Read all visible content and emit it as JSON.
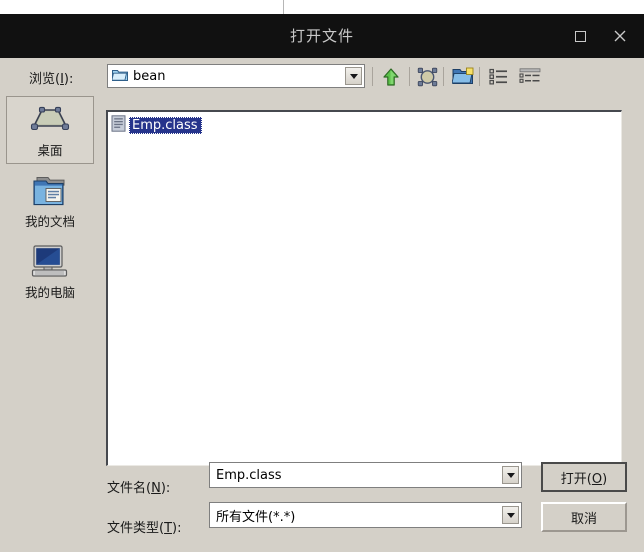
{
  "window": {
    "title": "打开文件",
    "maximize_icon": "maximize-icon",
    "close_icon": "close-icon"
  },
  "toolbar": {
    "browse_label_pre": "浏览(",
    "browse_label_key": "I",
    "browse_label_post": "):",
    "path_value": "bean",
    "path_folder_icon": "folder-icon",
    "buttons": [
      {
        "name": "up-one-level",
        "icon": "up-arrow-icon"
      },
      {
        "name": "home",
        "icon": "home-icon"
      },
      {
        "name": "new-folder",
        "icon": "new-folder-icon"
      },
      {
        "name": "list-view",
        "icon": "list-view-icon"
      },
      {
        "name": "details-view",
        "icon": "details-view-icon"
      }
    ]
  },
  "sidebar": {
    "items": [
      {
        "label": "桌面",
        "icon": "desktop-icon",
        "selected": true
      },
      {
        "label": "我的文档",
        "icon": "documents-folder-icon",
        "selected": false
      },
      {
        "label": "我的电脑",
        "icon": "computer-icon",
        "selected": false
      }
    ]
  },
  "file_list": {
    "items": [
      {
        "name": "Emp.class",
        "icon": "file-icon",
        "selected": true
      }
    ]
  },
  "form": {
    "filename_label_pre": "文件名(",
    "filename_label_key": "N",
    "filename_label_post": "):",
    "filename_value": "Emp.class",
    "filetype_label_pre": "文件类型(",
    "filetype_label_key": "T",
    "filetype_label_post": "):",
    "filetype_value": "所有文件(*.*)"
  },
  "buttons": {
    "open_pre": "打开(",
    "open_key": "O",
    "open_post": ")",
    "cancel": "取消"
  },
  "colors": {
    "dialog_bg": "#d4d0c8",
    "titlebar_bg": "#111111",
    "titlebar_fg": "#c9c9c9",
    "selection_bg": "#26348c",
    "field_bg": "#ffffff"
  }
}
